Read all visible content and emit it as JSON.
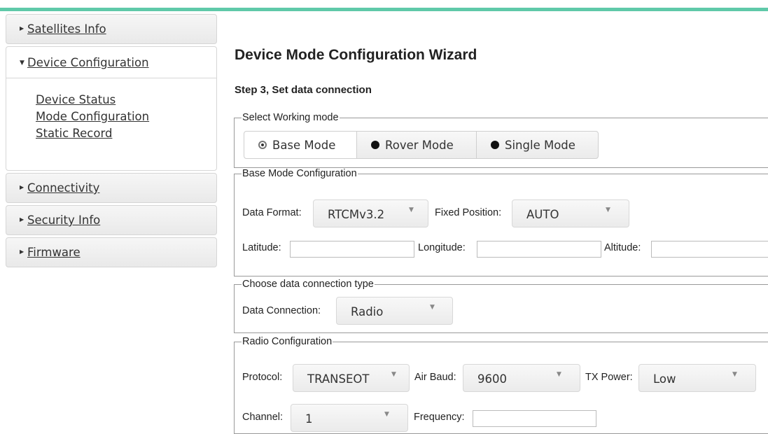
{
  "sidebar": {
    "sections": [
      {
        "label": "Satellites Info",
        "expanded": false
      },
      {
        "label": "Device Configuration",
        "expanded": true,
        "items": [
          "Device Status",
          "Mode Configuration",
          "Static Record"
        ]
      },
      {
        "label": "Connectivity",
        "expanded": false
      },
      {
        "label": "Security Info",
        "expanded": false
      },
      {
        "label": "Firmware",
        "expanded": false
      }
    ]
  },
  "main": {
    "title": "Device Mode Configuration Wizard",
    "step": "Step 3, Set data connection",
    "working_mode": {
      "legend": "Select Working mode",
      "options": [
        "Base Mode",
        "Rover Mode",
        "Single Mode"
      ],
      "selected": "Base Mode"
    },
    "base_config": {
      "legend": "Base Mode Configuration",
      "data_format_label": "Data Format:",
      "data_format_value": "RTCMv3.2",
      "fixed_position_label": "Fixed Position:",
      "fixed_position_value": "AUTO",
      "latitude_label": "Latitude:",
      "longitude_label": "Longitude:",
      "altitude_label": "Altitude:"
    },
    "connection": {
      "legend": "Choose data connection type",
      "label": "Data Connection:",
      "value": "Radio"
    },
    "radio": {
      "legend": "Radio Configuration",
      "protocol_label": "Protocol:",
      "protocol_value": "TRANSEOT",
      "air_baud_label": "Air Baud:",
      "air_baud_value": "9600",
      "tx_power_label": "TX Power:",
      "tx_power_value": "Low",
      "channel_label": "Channel:",
      "channel_value": "1",
      "frequency_label": "Frequency:"
    },
    "icons": {
      "dropdown": "caret-down-icon",
      "expand": "triangle-right-icon",
      "collapse": "triangle-down-icon"
    },
    "colors": {
      "accent_bar": "#5fc9a9"
    }
  }
}
